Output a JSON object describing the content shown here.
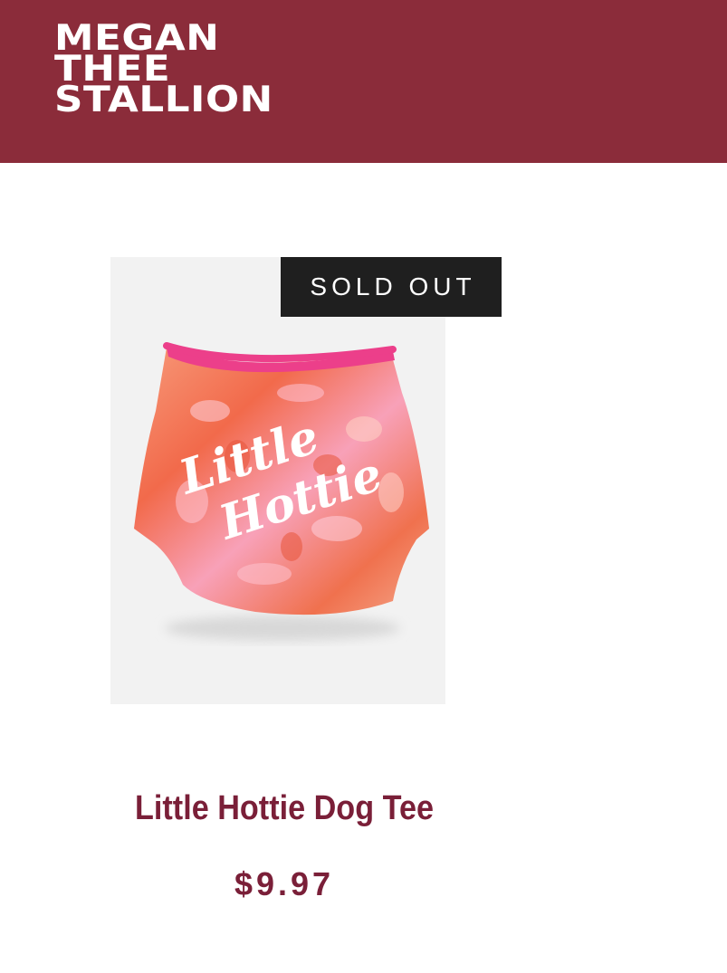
{
  "brand": {
    "line1": "MEGAN",
    "line2": "THEE",
    "line3": "STALLION",
    "header_color": "#8b2c3a"
  },
  "product": {
    "badge": "SOLD OUT",
    "image_text_line1": "Little",
    "image_text_line2": "Hottie",
    "title": "Little Hottie Dog Tee",
    "price": "$9.97",
    "accent_color": "#7a1f38"
  }
}
